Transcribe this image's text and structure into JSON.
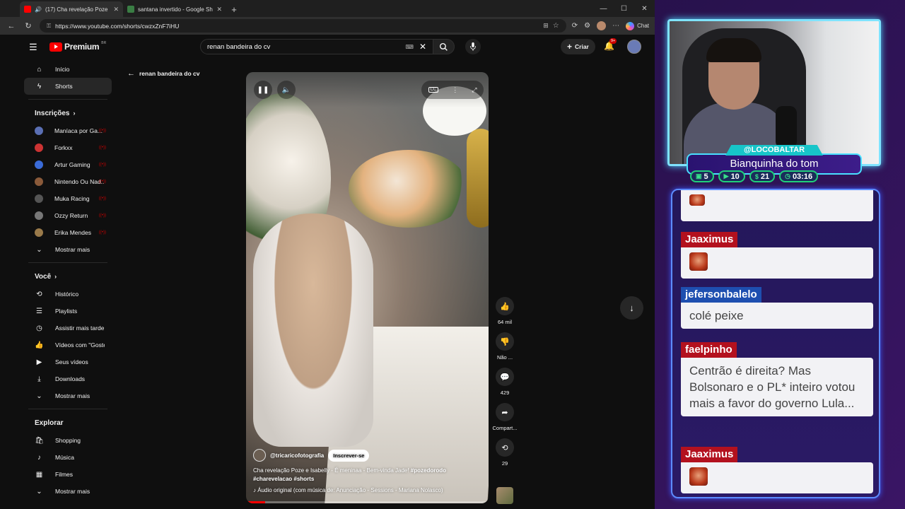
{
  "browser": {
    "tabs": [
      {
        "title": "(17) Cha revelação Poze e Isab...",
        "active": true,
        "icon": "youtube-icon"
      },
      {
        "title": "santana invertido - Google Shopp...",
        "active": false,
        "icon": "shopping-icon"
      }
    ],
    "url": "https://www.youtube.com/shorts/cwzxZnF7iHU",
    "chat_label": "Chat"
  },
  "youtube": {
    "logo_text": "Premium",
    "region": "BR",
    "search_value": "renan bandeira do cv",
    "create_label": "Criar",
    "notif_badge": "9+",
    "sidebar": {
      "home": "Início",
      "shorts": "Shorts",
      "subs_header": "Inscrições",
      "subs": [
        {
          "label": "Maníaca por Ga...",
          "color": "#5a6fb4"
        },
        {
          "label": "Forkxx",
          "color": "#cc3333"
        },
        {
          "label": "Artur Gaming",
          "color": "#3a6bd8"
        },
        {
          "label": "Nintendo Ou Nad...",
          "color": "#8a5a3a"
        },
        {
          "label": "Muka Racing",
          "color": "#555555"
        },
        {
          "label": "Ozzy Return",
          "color": "#777777"
        },
        {
          "label": "Erika Mendes",
          "color": "#9a7a4a"
        }
      ],
      "show_more": "Mostrar mais",
      "you_header": "Você",
      "you_items": [
        {
          "label": "Histórico",
          "icon": "history-icon"
        },
        {
          "label": "Playlists",
          "icon": "playlists-icon"
        },
        {
          "label": "Assistir mais tarde",
          "icon": "watch-later-icon"
        },
        {
          "label": "Vídeos com \"Gostei\"",
          "icon": "liked-icon"
        },
        {
          "label": "Seus vídeos",
          "icon": "your-videos-icon"
        },
        {
          "label": "Downloads",
          "icon": "download-icon"
        }
      ],
      "show_more_2": "Mostrar mais",
      "explore_header": "Explorar",
      "explore_items": [
        {
          "label": "Shopping",
          "icon": "shopping-bag-icon"
        },
        {
          "label": "Música",
          "icon": "music-icon"
        },
        {
          "label": "Filmes",
          "icon": "film-icon"
        }
      ],
      "show_more_3": "Mostrar mais"
    },
    "back_label": "renan bandeira do cv",
    "short": {
      "channel": "@tricaricofotografia",
      "subscribe": "Inscrever-se",
      "description": "Cha revelação Poze  e Isabelly - É meninaa - Bem-vinda Jade! ",
      "tags_1": "#pozedorodo",
      "tags_2": "#charevelacao #shorts",
      "audio": "Áudio original (com música de: Anunciação - Sessions - Mariana Nolasco)",
      "progress": 0.08
    },
    "actions": {
      "likes": "64 mil",
      "dislike": "Não ...",
      "comments": "429",
      "share": "Compart...",
      "remix": "29"
    }
  },
  "overlay": {
    "handle": "@LOCOBALTAR",
    "title": "Bianquinha do tom",
    "stats": [
      {
        "icon": "chat-icon",
        "value": "5"
      },
      {
        "icon": "video-icon",
        "value": "10"
      },
      {
        "icon": "money-icon",
        "value": "21"
      },
      {
        "icon": "clock-icon",
        "value": "03:16"
      }
    ],
    "chat": [
      {
        "user": "Jaaximus",
        "text": "",
        "emote": true
      },
      {
        "user": "jefersonbalelo",
        "text": "colé peixe",
        "emote": false
      },
      {
        "user": "faelpinho",
        "text": "Centrão é direita? Mas Bolsonaro e o PL* inteiro votou mais a favor do governo Lula...",
        "emote": false
      },
      {
        "user": "Jaaximus",
        "text": "",
        "emote": true
      }
    ]
  }
}
